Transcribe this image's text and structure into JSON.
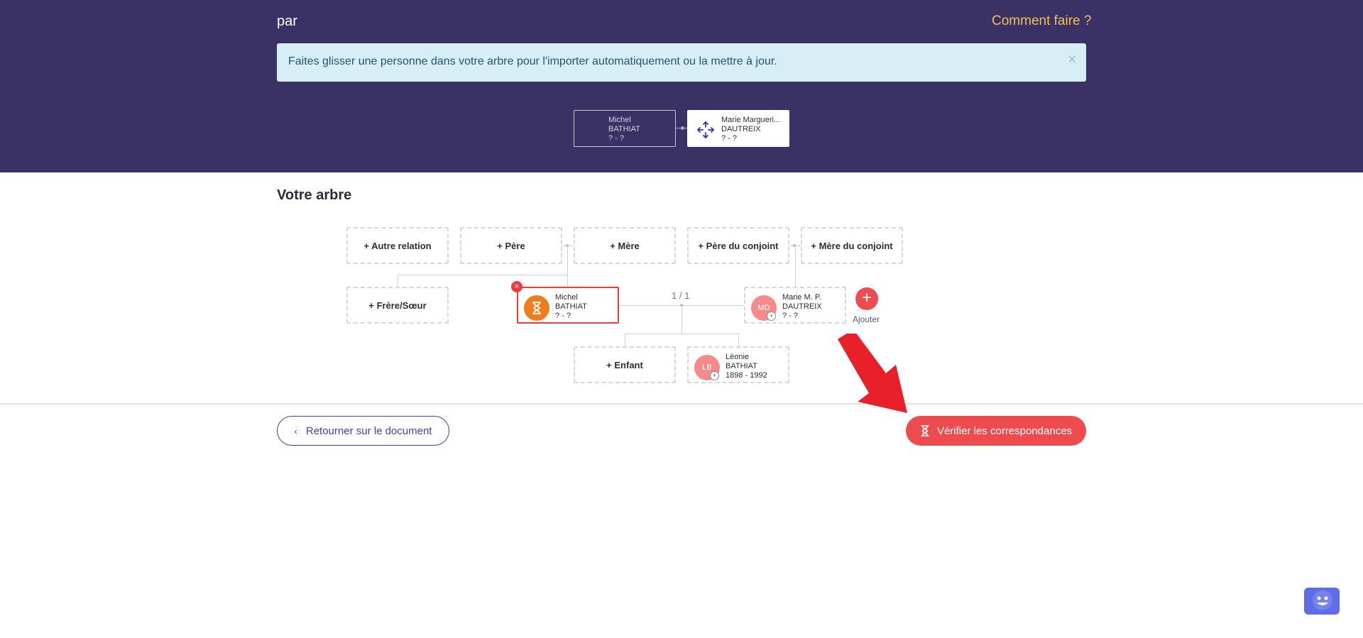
{
  "header": {
    "title": "par",
    "help_link": "Comment faire ?",
    "alert_text": "Faites glisser une personne dans votre arbre pour l'importer automatiquement ou la mettre à jour.",
    "alert_close": "×",
    "import_source": {
      "first_name": "Michel",
      "last_name": "BATHIAT",
      "dates": "? - ?"
    },
    "import_target": {
      "first_name": "Marie Margueri...",
      "last_name": "DAUTREIX",
      "dates": "? - ?"
    }
  },
  "tree": {
    "title": "Votre arbre",
    "slots": {
      "other_relation": "+ Autre relation",
      "father": "+ Père",
      "mother": "+ Mère",
      "spouse_father": "+ Père du conjoint",
      "spouse_mother": "+ Mère du conjoint",
      "sibling": "+ Frère/Sœur",
      "child": "+ Enfant"
    },
    "main_person": {
      "first_name": "Michel",
      "last_name": "BATHIAT",
      "dates": "? - ?",
      "remove": "×"
    },
    "spouse": {
      "initials": "MD",
      "first_name": "Marie M. P.",
      "last_name": "DAUTREIX",
      "dates": "? - ?"
    },
    "child_person": {
      "initials": "LB",
      "first_name": "Léonie",
      "last_name": "BATHIAT",
      "dates": "1898 - 1992"
    },
    "spouse_pager": "1 / 1",
    "add_button": "+",
    "add_label": "Ajouter"
  },
  "footer": {
    "back_label": "Retourner sur le document",
    "back_chevron": "‹",
    "verify_label": "Vérifier les correspondances"
  },
  "colors": {
    "header_bg": "#3a3165",
    "accent_red": "#ee4b4e",
    "link_yellow": "#f2bf57",
    "primary_purple": "#4a3ab0"
  }
}
